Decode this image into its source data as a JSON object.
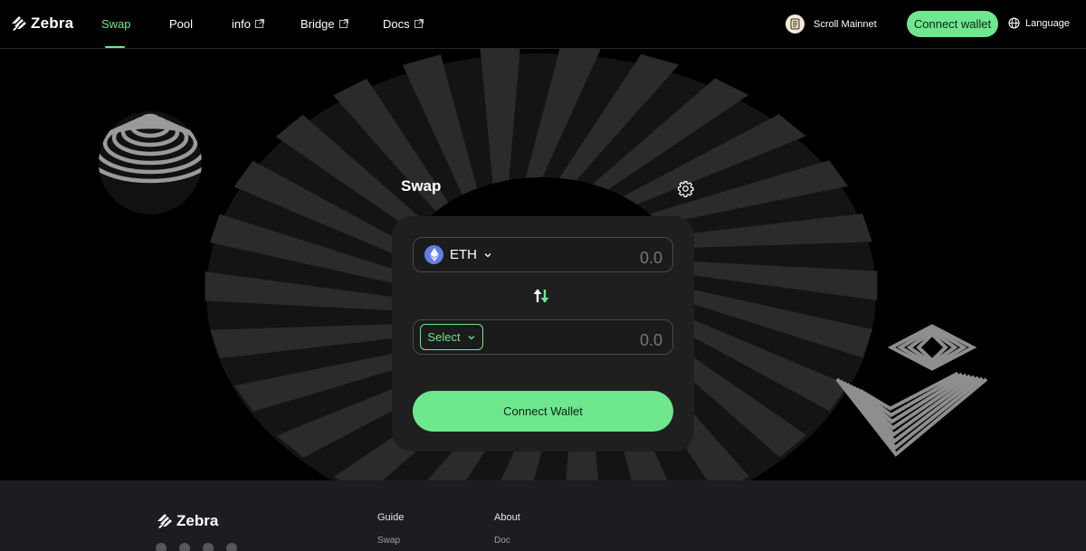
{
  "brand": {
    "name": "Zebra"
  },
  "nav": {
    "items": [
      {
        "label": "Swap",
        "external": false,
        "active": true
      },
      {
        "label": "Pool",
        "external": false,
        "active": false
      },
      {
        "label": "info",
        "external": true,
        "active": false
      },
      {
        "label": "Bridge",
        "external": true,
        "active": false
      },
      {
        "label": "Docs",
        "external": true,
        "active": false
      }
    ]
  },
  "header": {
    "network": "Scroll Mainnet",
    "connect_label": "Connect wallet",
    "language_label": "Language"
  },
  "swap": {
    "title": "Swap",
    "from": {
      "token": "ETH",
      "amount": "0.0"
    },
    "to": {
      "select_label": "Select",
      "amount": "0.0"
    },
    "connect_label": "Connect Wallet"
  },
  "footer": {
    "brand": "Zebra",
    "columns": [
      {
        "heading": "Guide",
        "link": "Swap"
      },
      {
        "heading": "About",
        "link": "Doc"
      }
    ],
    "socials": [
      "github-icon",
      "medium-icon",
      "twitter-icon",
      "discord-icon"
    ]
  },
  "colors": {
    "accent": "#6ee78f",
    "background": "#000000",
    "card": "#1f1f1f",
    "footer": "#1c1d20"
  }
}
